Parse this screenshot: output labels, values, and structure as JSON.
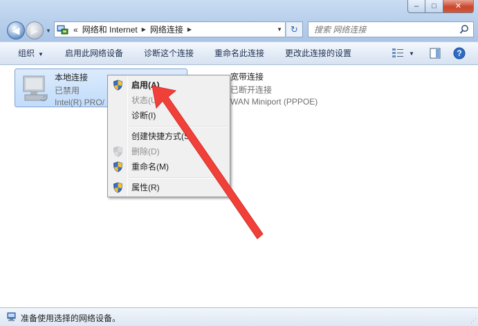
{
  "window": {
    "minimize_glyph": "–",
    "maximize_glyph": "□",
    "close_glyph": "✕"
  },
  "nav": {
    "back_glyph": "◀",
    "forward_glyph": "▶",
    "dropdown_glyph": "▼"
  },
  "address": {
    "overflow": "«",
    "crumbs": [
      "网络和 Internet",
      "网络连接"
    ],
    "separator": "▶",
    "dropdown_glyph": "▼",
    "refresh_glyph": "↻"
  },
  "search": {
    "placeholder": "搜索 网络连接",
    "value": ""
  },
  "toolbar": {
    "organize": "组织",
    "enable": "启用此网络设备",
    "diagnose": "诊断这个连接",
    "rename": "重命名此连接",
    "change_settings": "更改此连接的设置",
    "caret": "▼"
  },
  "connections": [
    {
      "name": "本地连接",
      "status": "已禁用",
      "device": "Intel(R) PRO/",
      "icon": "lan-disabled-icon"
    },
    {
      "name": "宽带连接",
      "status": "已断开连接",
      "device": "WAN Miniport (PPPOE)",
      "icon": "broadband-icon"
    }
  ],
  "context_menu": {
    "items": [
      {
        "label": "启用(A)",
        "bold": true,
        "disabled": false,
        "icon": "uac-shield-icon"
      },
      {
        "label": "状态(U)",
        "bold": false,
        "disabled": true,
        "icon": ""
      },
      {
        "label": "诊断(I)",
        "bold": false,
        "disabled": false,
        "icon": ""
      },
      {
        "label": "创建快捷方式(S)",
        "bold": false,
        "disabled": false,
        "icon": ""
      },
      {
        "label": "删除(D)",
        "bold": false,
        "disabled": true,
        "icon": "uac-shield-icon"
      },
      {
        "label": "重命名(M)",
        "bold": false,
        "disabled": false,
        "icon": "uac-shield-icon"
      },
      {
        "label": "属性(R)",
        "bold": false,
        "disabled": false,
        "icon": "uac-shield-icon"
      }
    ]
  },
  "statusbar": {
    "text": "准备使用选择的网络设备。",
    "icon": "network-device-icon"
  },
  "colors": {
    "annotation_arrow": "#f0403a",
    "selection": "#c1dcfb"
  }
}
